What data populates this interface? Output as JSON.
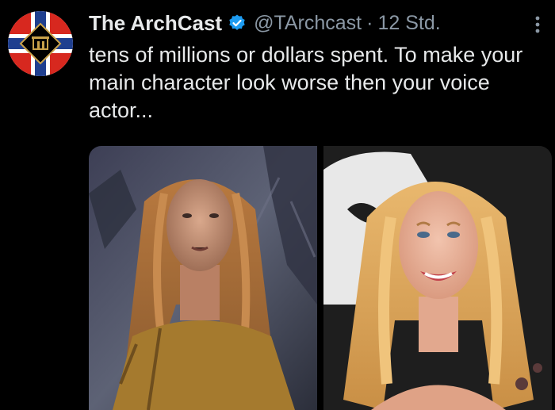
{
  "tweet": {
    "author": {
      "display_name": "The ArchCast",
      "handle": "@TArchcast",
      "verified": true,
      "avatar_icon": "archcast-logo-icon"
    },
    "separator": "·",
    "timestamp": "12 Std.",
    "text": "tens of millions or dollars spent. To make your main character look worse then your voice actor...",
    "media": [
      {
        "kind": "photo",
        "subject": "game-character-render"
      },
      {
        "kind": "photo",
        "subject": "actress-portrait"
      }
    ]
  },
  "colors": {
    "background": "#000000",
    "text_primary": "#e7e9ea",
    "text_secondary": "#8b98a5",
    "verified_badge": "#1d9bf0"
  }
}
